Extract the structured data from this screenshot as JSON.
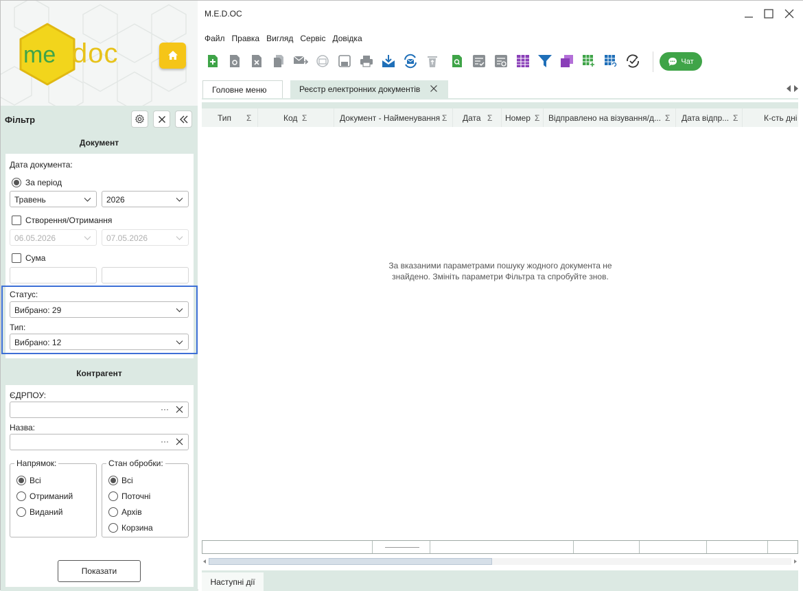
{
  "app": {
    "title": "M.E.D.OC",
    "logo_prefix": "me",
    "logo_suffix": "doc"
  },
  "menu": [
    "Файл",
    "Правка",
    "Вигляд",
    "Сервіс",
    "Довідка"
  ],
  "toolbar": {
    "chat_label": "Чат",
    "icons": [
      "new-document-icon",
      "view-document-icon",
      "delete-document-icon",
      "copy-document-icon",
      "send-mail-icon",
      "receive-mail-icon",
      "save-icon",
      "print-icon",
      "inbox-download-icon",
      "sync-mail-icon",
      "trash-icon",
      "search-document-icon",
      "sign-icon",
      "edit-list-icon",
      "table-purple-icon",
      "filter-icon",
      "layers-icon",
      "export-table-icon",
      "refresh-table-icon",
      "verify-icon"
    ],
    "colors": {
      "green": "#3fa448",
      "blue": "#1f6fb8",
      "purple": "#8a3fb8",
      "grey": "#8a8f93"
    }
  },
  "tabs": [
    {
      "label": "Головне меню",
      "active": false
    },
    {
      "label": "Реєстр електронних документів",
      "active": true
    }
  ],
  "filter": {
    "title": "Фільтр",
    "document_section": "Документ",
    "date_label": "Дата документа:",
    "period_label": "За період",
    "month": "Травень",
    "year": "2026",
    "created_label": "Створення/Отримання",
    "date_from": "06.05.2026",
    "date_to": "07.05.2026",
    "sum_label": "Сума",
    "status_label": "Статус:",
    "status_value": "Вибрано: 29",
    "type_label": "Тип:",
    "type_value": "Вибрано: 12",
    "counterparty_section": "Контрагент",
    "edrpou_label": "ЄДРПОУ:",
    "name_label": "Назва:",
    "direction_legend": "Напрямок:",
    "direction_options": [
      "Всі",
      "Отриманий",
      "Виданий"
    ],
    "processing_legend": "Стан обробки:",
    "processing_options": [
      "Всі",
      "Поточні",
      "Архів",
      "Корзина"
    ],
    "show_button": "Показати"
  },
  "grid": {
    "sum_symbol": "Σ",
    "columns": [
      "Тип",
      "Код",
      "Документ - Найменування",
      "Дата",
      "Номер",
      "Відправлено на  візування/д...",
      "Дата відпр...",
      "К-сть дні"
    ],
    "empty_line1": "За вказаними параметрами пошуку жодного документа не",
    "empty_line2": "знайдено. Змініть параметри Фільтра та спробуйте знов."
  },
  "bottom": {
    "next_actions": "Наступні дії"
  },
  "colors": {
    "panel_bg": "#dce9e3",
    "highlight": "#3d6fd6",
    "logo_yellow": "#f5c518"
  }
}
